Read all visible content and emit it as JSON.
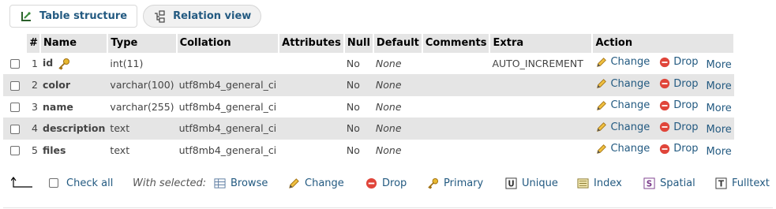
{
  "tabs": [
    {
      "label": "Table structure",
      "icon": "table-structure-icon"
    },
    {
      "label": "Relation view",
      "icon": "relation-view-icon"
    }
  ],
  "columns": [
    "#",
    "Name",
    "Type",
    "Collation",
    "Attributes",
    "Null",
    "Default",
    "Comments",
    "Extra",
    "Action"
  ],
  "rows": [
    {
      "num": "1",
      "name": "id",
      "type": "int(11)",
      "collation": "",
      "attributes": "",
      "null": "No",
      "default": "None",
      "comments": "",
      "extra": "AUTO_INCREMENT",
      "primary_key": true
    },
    {
      "num": "2",
      "name": "color",
      "type": "varchar(100)",
      "collation": "utf8mb4_general_ci",
      "attributes": "",
      "null": "No",
      "default": "None",
      "comments": "",
      "extra": ""
    },
    {
      "num": "3",
      "name": "name",
      "type": "varchar(255)",
      "collation": "utf8mb4_general_ci",
      "attributes": "",
      "null": "No",
      "default": "None",
      "comments": "",
      "extra": ""
    },
    {
      "num": "4",
      "name": "description",
      "type": "text",
      "collation": "utf8mb4_general_ci",
      "attributes": "",
      "null": "No",
      "default": "None",
      "comments": "",
      "extra": ""
    },
    {
      "num": "5",
      "name": "files",
      "type": "text",
      "collation": "utf8mb4_general_ci",
      "attributes": "",
      "null": "No",
      "default": "None",
      "comments": "",
      "extra": ""
    }
  ],
  "row_actions": {
    "change": "Change",
    "drop": "Drop",
    "more": "More"
  },
  "bottom": {
    "check_all": "Check all",
    "with_selected": "With selected:",
    "browse": "Browse",
    "change": "Change",
    "drop": "Drop",
    "primary": "Primary",
    "unique": "Unique",
    "index": "Index",
    "spatial": "Spatial",
    "fulltext": "Fulltext"
  },
  "colors": {
    "link": "#235a81",
    "header_bg": "#e5e5e5",
    "drop_red": "#e0453a",
    "pencil": "#e0a020"
  }
}
